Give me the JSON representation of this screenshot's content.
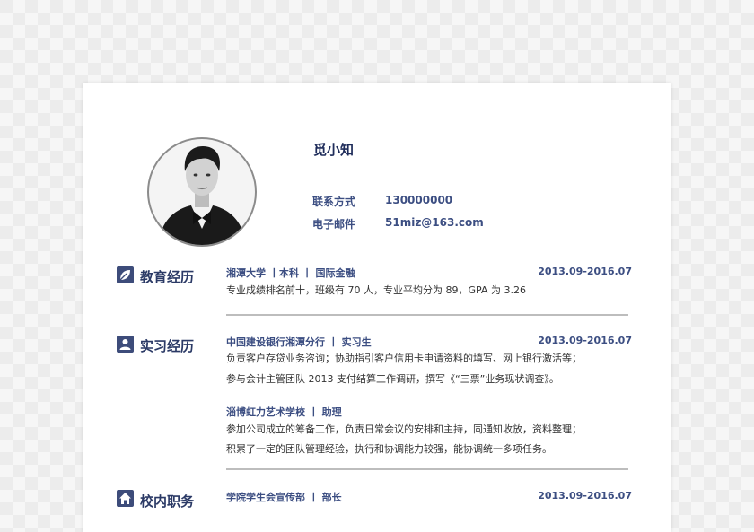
{
  "profile": {
    "name": "觅小知",
    "contact_label": "联系方式",
    "contact_value": "130000000",
    "email_label": "电子邮件",
    "email_value": "51miz@163.com"
  },
  "sections": {
    "education": {
      "title": "教育经历",
      "entries": [
        {
          "title": "湘潭大学  丨本科  丨 国际金融",
          "date": "2013.09-2016.07",
          "lines": [
            "专业成绩排名前十，班级有 70 人，专业平均分为 89，GPA 为 3.26"
          ]
        }
      ]
    },
    "internship": {
      "title": "实习经历",
      "entries": [
        {
          "title": "中国建设银行湘潭分行  丨 实习生",
          "date": "2013.09-2016.07",
          "lines": [
            "负责客户存贷业务咨询；协助指引客户信用卡申请资料的填写、网上银行激活等；",
            "参与会计主管团队 2013 支付结算工作调研，撰写《“三票”业务现状调查》。"
          ]
        },
        {
          "title": "淄博虹力艺术学校  丨  助理",
          "date": "",
          "lines": [
            "参加公司成立的筹备工作，负责日常会议的安排和主持，同通知收放，资料整理；",
            "积累了一定的团队管理经验，执行和协调能力较强，能协调统一多项任务。"
          ]
        }
      ]
    },
    "campus": {
      "title": "校内职务",
      "entries": [
        {
          "title": "学院学生会宣传部  丨  部长",
          "date": "2013.09-2016.07"
        }
      ]
    }
  },
  "colors": {
    "accent": "#3c4e82",
    "divider": "#bdbdbd"
  }
}
